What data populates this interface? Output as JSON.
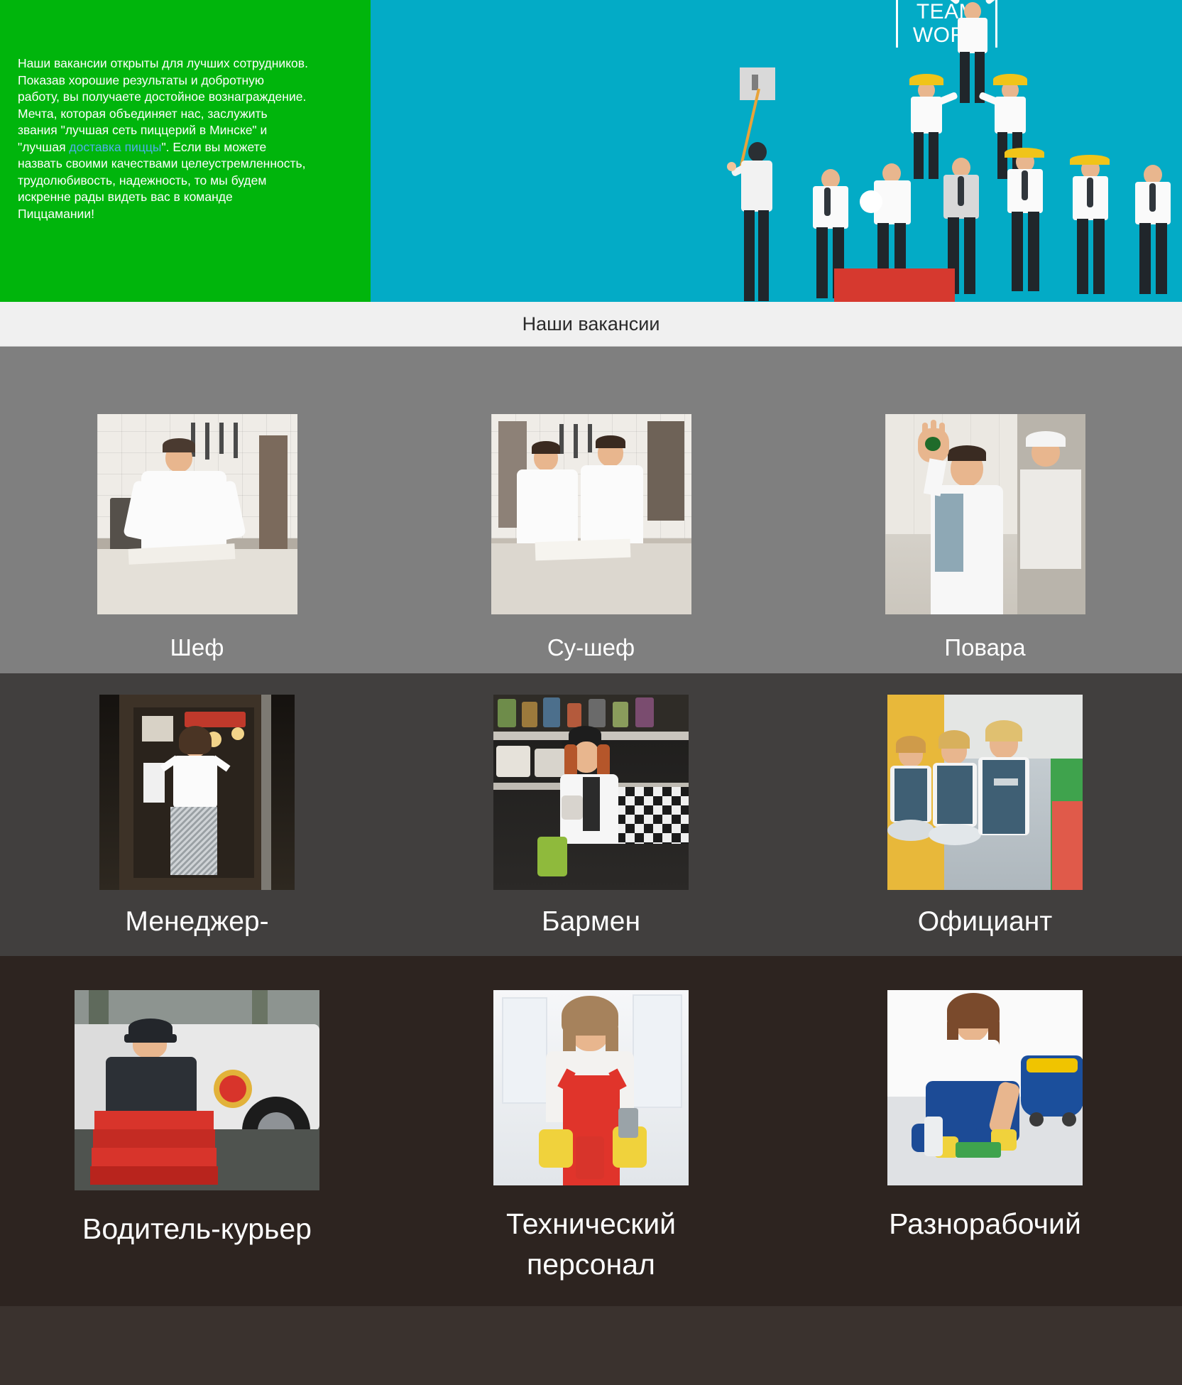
{
  "banner": {
    "paragraph_pre": "Наши вакансии открыты для лучших сотрудников. Показав хорошие результаты и добротную работу, вы получаете достойное вознаграждение. Мечта, которая объединяет нас, заслужить звания \"лучшая сеть пиццерий в Минске\" и \"лучшая ",
    "paragraph_link": "доставка пиццы",
    "paragraph_post": "\". Если вы можете назвать своими качествами целеустремленность, трудолюбивость, надежность, то мы будем искренне рады видеть вас в команде Пиццамании!",
    "logo_line1": "TEAM",
    "logo_line2": "WORK",
    "green_color": "#00b50c",
    "blue_color": "#03abc6",
    "link_color": "#4fb0e8"
  },
  "section": {
    "title": "Наши вакансии",
    "title_bg": "#f0f0f0",
    "title_color": "#2b2b2b"
  },
  "vacancies": {
    "row1": {
      "bg": "#7f7f7f",
      "items": [
        {
          "label": "Шеф",
          "image": "chef-portrait-photo"
        },
        {
          "label": "Су-шеф",
          "image": "sous-chefs-kitchen-photo"
        },
        {
          "label": "Повара",
          "image": "cook-waving-photo"
        }
      ]
    },
    "row2": {
      "bg": "#413f3e",
      "items": [
        {
          "label": "Менеджер-",
          "image": "manager-entrance-photo"
        },
        {
          "label": "Бармен",
          "image": "bartender-photo"
        },
        {
          "label": "Официант",
          "image": "waitresses-photo"
        }
      ]
    },
    "row3": {
      "bg": "#2d2420",
      "items": [
        {
          "label": "Водитель-курьер",
          "image": "courier-pizza-boxes-photo"
        },
        {
          "label": "Технический\nперсонал",
          "image": "cleaning-staff-photo"
        },
        {
          "label": "Разнорабочий",
          "image": "handy-worker-photo"
        }
      ]
    }
  }
}
